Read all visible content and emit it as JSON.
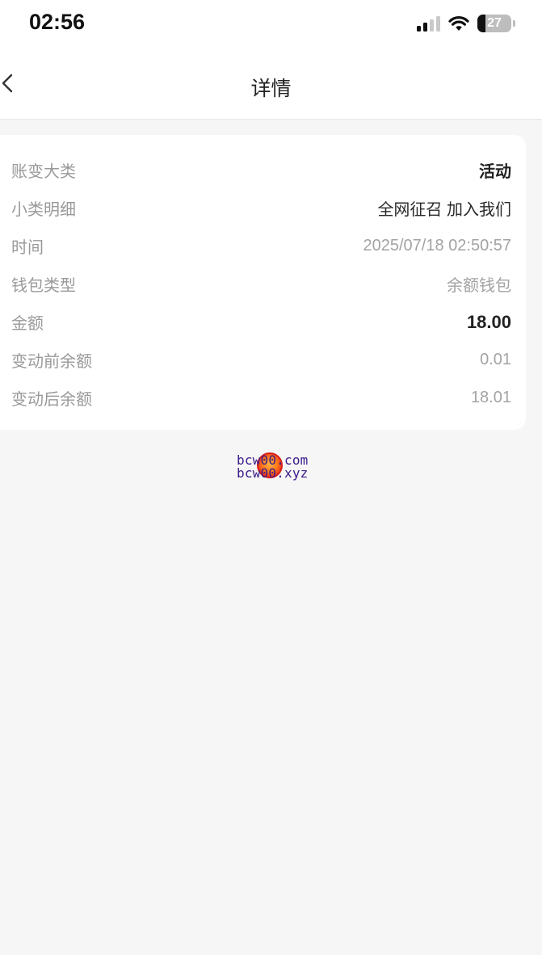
{
  "status_bar": {
    "time": "02:56",
    "battery": "27"
  },
  "nav": {
    "title": "详情"
  },
  "details": [
    {
      "label": "账变大类",
      "value": "活动"
    },
    {
      "label": "小类明细",
      "value": "全网征召 加入我们"
    },
    {
      "label": "时间",
      "value": "2025/07/18 02:50:57"
    },
    {
      "label": "钱包类型",
      "value": "余额钱包"
    },
    {
      "label": "金额",
      "value": "18.00"
    },
    {
      "label": "变动前余额",
      "value": "0.01"
    },
    {
      "label": "变动后余额",
      "value": "18.01"
    }
  ],
  "watermark": {
    "line1": "bcw00.com",
    "line2": "bcw00.xyz"
  },
  "colors": {
    "background": "#f6f6f6",
    "card": "#ffffff",
    "label_text": "#9a9a9a",
    "emphasis_text": "#222222"
  }
}
